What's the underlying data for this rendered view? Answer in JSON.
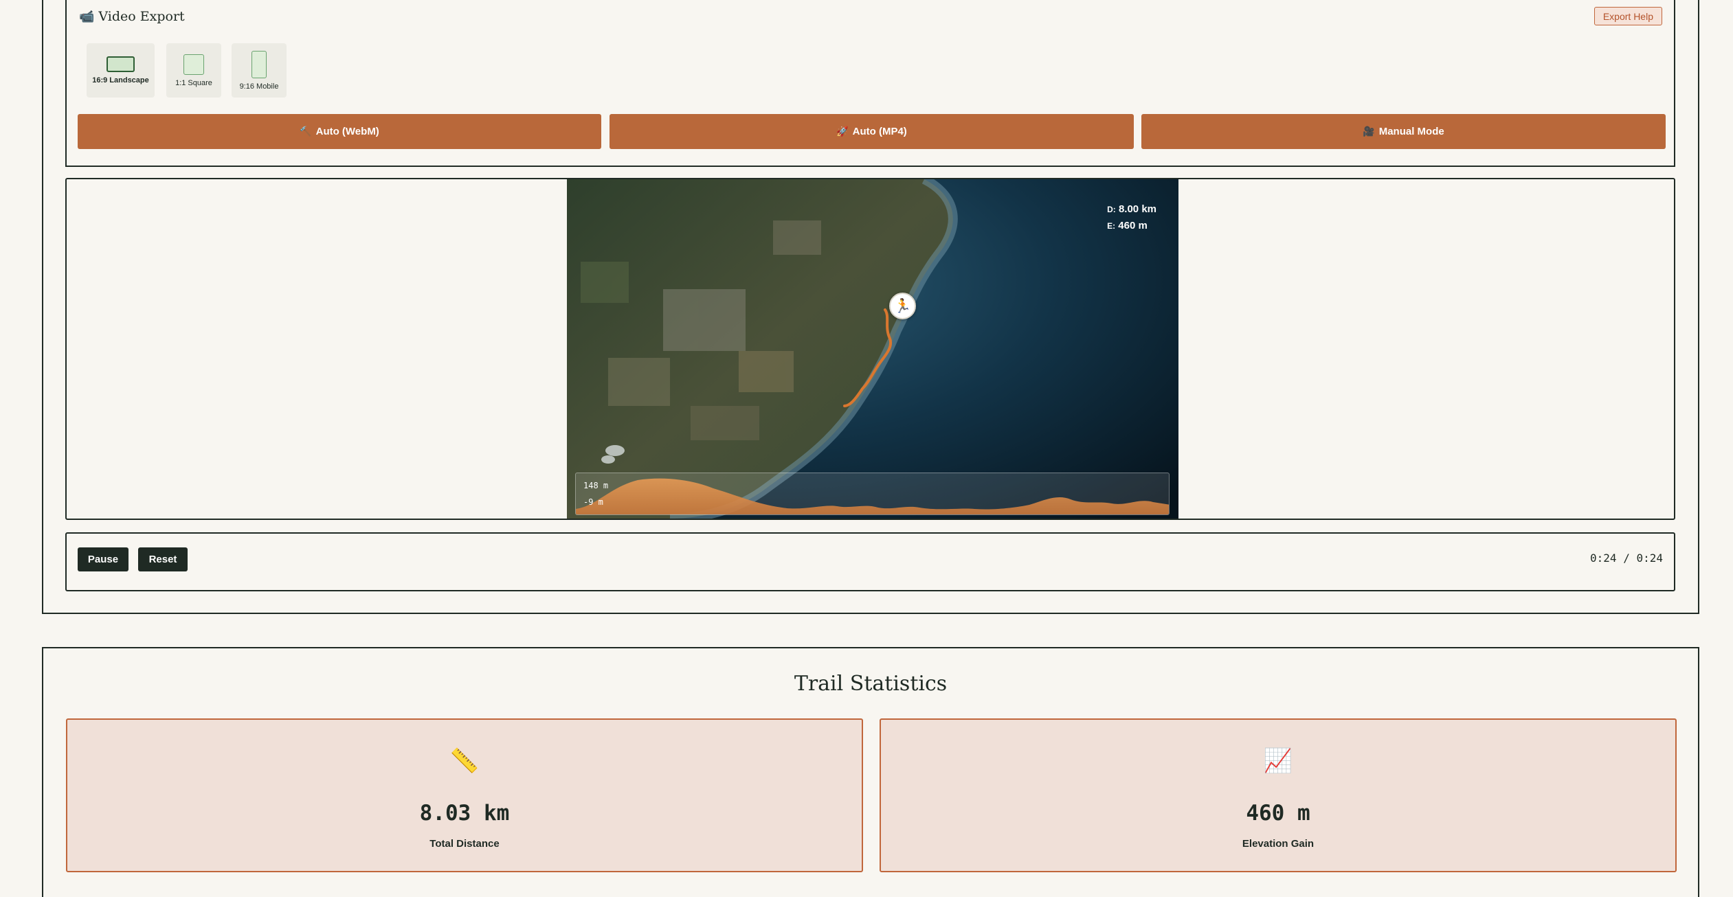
{
  "export": {
    "title": "Video Export",
    "help_label": "Export Help",
    "formats": [
      {
        "label": "16:9 Landscape",
        "selected": true
      },
      {
        "label": "1:1 Square",
        "selected": false
      },
      {
        "label": "9:16 Mobile",
        "selected": false
      }
    ],
    "actions": [
      {
        "label": "Auto (WebM)",
        "icon": "hammer-icon"
      },
      {
        "label": "Auto (MP4)",
        "icon": "rocket-icon"
      },
      {
        "label": "Manual Mode",
        "icon": "camera-icon"
      }
    ]
  },
  "map": {
    "distance_key": "D:",
    "distance_value": "8.00 km",
    "elevation_key": "E:",
    "elevation_value": "460 m",
    "elev_max": "148 m",
    "elev_min": "-9 m",
    "runner_icon": "runner-icon"
  },
  "playback": {
    "pause_label": "Pause",
    "reset_label": "Reset",
    "time": "0:24 / 0:24"
  },
  "stats": {
    "title": "Trail Statistics",
    "cards": [
      {
        "icon": "ruler-icon",
        "value": "8.03 km",
        "label": "Total Distance"
      },
      {
        "icon": "chart-up-icon",
        "value": "460 m",
        "label": "Elevation Gain"
      }
    ]
  },
  "colors": {
    "accent": "#b9683a",
    "dark": "#1f2a24",
    "background": "#f8f6f1",
    "card_bg": "#f0e0d8",
    "trail": "#d9772f"
  }
}
